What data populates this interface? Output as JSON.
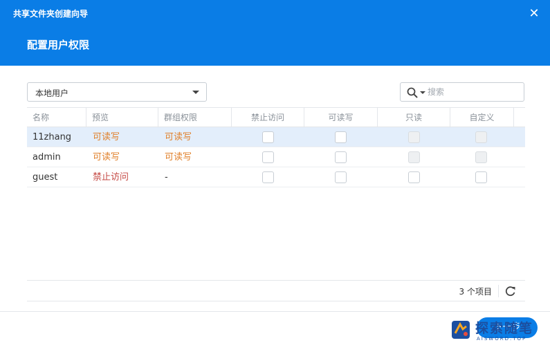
{
  "window": {
    "title": "共享文件夹创建向导",
    "step_title": "配置用户权限",
    "accent_color": "#0a7de6"
  },
  "toolbar": {
    "user_type": "本地用户",
    "search": {
      "placeholder": "搜索",
      "value": ""
    }
  },
  "table": {
    "columns": [
      "名称",
      "预览",
      "群组权限",
      "禁止访问",
      "可读写",
      "只读",
      "自定义"
    ],
    "rows": [
      {
        "name": "11zhang",
        "preview": "可读写",
        "group_permission": "可读写",
        "deny": false,
        "read_write": false,
        "read_only": false,
        "custom": false,
        "selected": true
      },
      {
        "name": "admin",
        "preview": "可读写",
        "group_permission": "可读写",
        "deny": false,
        "read_write": false,
        "read_only": false,
        "custom": false,
        "selected": false
      },
      {
        "name": "guest",
        "preview": "禁止访问",
        "group_permission": "-",
        "deny": false,
        "read_write": false,
        "read_only": false,
        "custom": false,
        "selected": false
      }
    ],
    "footer": {
      "count_text": "3 个项目"
    }
  },
  "footer": {
    "next_label": "下一步"
  },
  "watermark": {
    "text": "探索随笔",
    "sub": "AISWORD.TOP"
  },
  "icons": [
    "close-icon",
    "search-icon",
    "chevron-down-icon",
    "refresh-icon"
  ],
  "colors": {
    "header": "#0a7de6",
    "rw_text": "#e0802b",
    "deny_text": "#c54a45",
    "selected_row": "#e3eefb"
  }
}
